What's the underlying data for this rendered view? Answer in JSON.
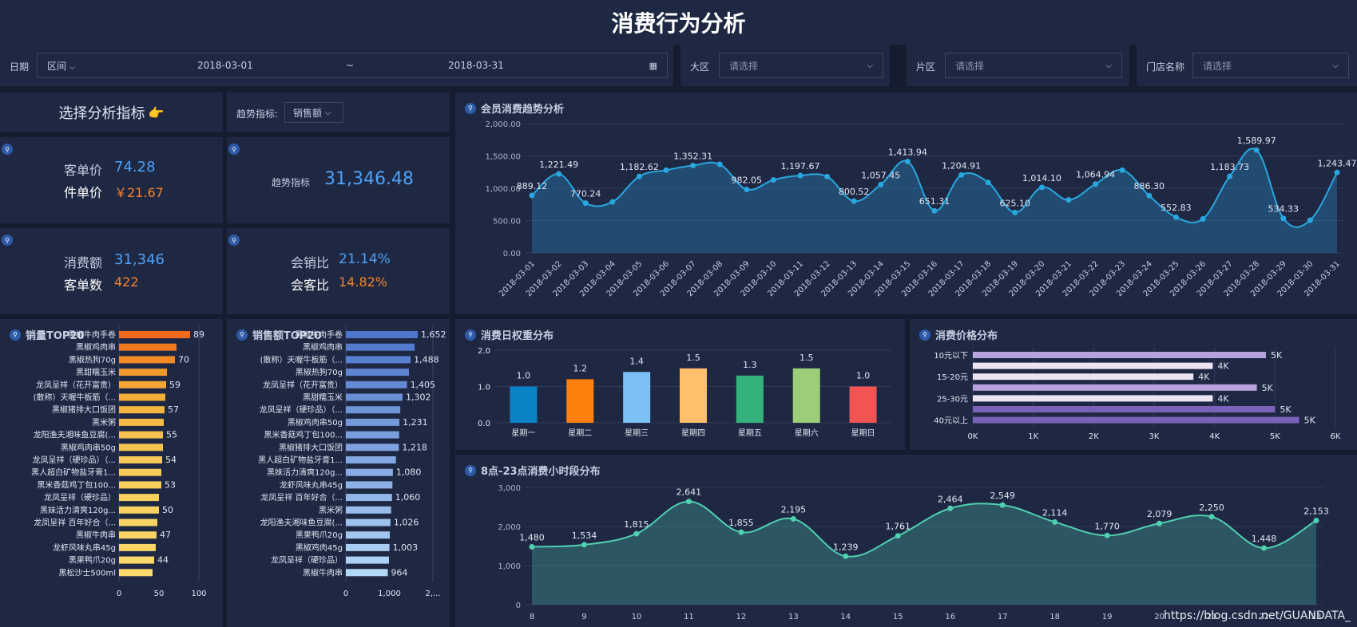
{
  "page_title": "消费行为分析",
  "filters": {
    "date_label": "日期",
    "range_mode": "区间",
    "date_from": "2018-03-01",
    "range_sep": "~",
    "date_to": "2018-03-31",
    "region_label": "大区",
    "region_placeholder": "请选择",
    "area_label": "片区",
    "area_placeholder": "请选择",
    "store_label": "门店名称",
    "store_placeholder": "请选择"
  },
  "selector": {
    "title": "选择分析指标",
    "pointer": "👉",
    "trend_label": "趋势指标:",
    "trend_value": "销售额"
  },
  "kpis": {
    "avg_price_label": "客单价",
    "avg_price": "74.28",
    "unit_price_label": "件单价",
    "unit_price": "￥21.67",
    "trend_label": "趋势指标",
    "trend_value": "31,346.48",
    "spend_label": "消费额",
    "spend": "31,346",
    "orders_label": "客单数",
    "orders": "422",
    "member_sales_label": "会销比",
    "member_sales": "21.14%",
    "member_customers_label": "会客比",
    "member_customers": "14.82%"
  },
  "colors": {
    "accent": "#4ea0f5",
    "orange": "#f5832b",
    "line_trend": "#29a8e0",
    "line_hour": "#4fd1b0"
  },
  "chart_data": [
    {
      "id": "trend",
      "type": "area",
      "title": "会员消费趋势分析",
      "x": [
        "2018-03-01",
        "2018-03-02",
        "2018-03-03",
        "2018-03-04",
        "2018-03-05",
        "2018-03-06",
        "2018-03-07",
        "2018-03-08",
        "2018-03-09",
        "2018-03-10",
        "2018-03-11",
        "2018-03-12",
        "2018-03-13",
        "2018-03-14",
        "2018-03-15",
        "2018-03-16",
        "2018-03-17",
        "2018-03-18",
        "2018-03-19",
        "2018-03-20",
        "2018-03-21",
        "2018-03-22",
        "2018-03-23",
        "2018-03-24",
        "2018-03-25",
        "2018-03-26",
        "2018-03-27",
        "2018-03-28",
        "2018-03-29",
        "2018-03-30",
        "2018-03-31"
      ],
      "values": [
        889.12,
        1221.49,
        770.24,
        790,
        1182.62,
        1280,
        1352.31,
        1370,
        982.05,
        1130,
        1197.67,
        1180,
        800.52,
        1057.45,
        1413.94,
        651.31,
        1204.91,
        1090,
        625.1,
        1014.1,
        820,
        1064.94,
        1280,
        886.3,
        552.83,
        525,
        1183.73,
        1589.97,
        534.33,
        505,
        1243.47
      ],
      "labels": [
        "889.12",
        "1,221.49",
        "770.24",
        "",
        "1,182.62",
        "",
        "1,352.31",
        "",
        "982.05",
        "",
        "1,197.67",
        "",
        "800.52",
        "1,057.45",
        "1,413.94",
        "651.31",
        "1,204.91",
        "",
        "625.10",
        "1,014.10",
        "",
        "1,064.94",
        "",
        "886.30",
        "552.83",
        "",
        "1,183.73",
        "1,589.97",
        "534.33",
        "",
        "1,243.47"
      ],
      "yticks": [
        "0.00",
        "500.00",
        "1,000.00",
        "1,500.00",
        "2,000.00"
      ],
      "ylim": [
        0,
        2000
      ]
    },
    {
      "id": "qty_top20",
      "type": "bar",
      "title": "销量TOP20",
      "categories": [
        "黑椒牛肉手卷",
        "黑椒鸡肉串",
        "黑椒热狗70g",
        "黑甜糯玉米",
        "龙凤呈祥（花开富贵）",
        "(散称）天喔牛板筋（...",
        "黑椒猪排大口饭团",
        "黑米粥",
        "龙阳渔夫湘味鱼豆腐(...",
        "黑椒鸡肉串50g",
        "龙凤呈祥（硬珍品）（...",
        "黑人超白矿物盐牙膏1...",
        "黑米香菇鸡丁包100...",
        "龙凤呈祥（硬珍品）",
        "黑妹活力清爽120g...",
        "龙凤呈祥 百年好合（...",
        "黑椒牛肉串",
        "龙虾风味丸串45g",
        "黑果鸭爪20g",
        "黑松沙士500ml"
      ],
      "values": [
        89,
        72,
        70,
        60,
        59,
        58,
        57,
        56,
        55,
        55,
        54,
        53,
        53,
        50,
        50,
        48,
        47,
        46,
        44,
        42
      ],
      "labels": [
        "89",
        "",
        "70",
        "",
        "59",
        "",
        "57",
        "",
        "55",
        "",
        "54",
        "",
        "53",
        "",
        "50",
        "",
        "47",
        "",
        "44",
        ""
      ],
      "xticks": [
        "0",
        "50",
        "100"
      ],
      "xlim": [
        0,
        100
      ]
    },
    {
      "id": "amt_top20",
      "type": "bar",
      "title": "销售额TOP20",
      "categories": [
        "黑椒牛肉手卷",
        "黑椒鸡肉串",
        "(散称）天喔牛板筋（...",
        "黑椒热狗70g",
        "龙凤呈祥（花开富贵）",
        "黑甜糯玉米",
        "龙凤呈祥（硬珍品）（...",
        "黑椒鸡肉串50g",
        "黑米香菇鸡丁包100...",
        "黑椒猪排大口饭团",
        "黑人超白矿物盐牙膏1...",
        "黑妹活力清爽120g...",
        "龙虾风味丸串45g",
        "龙凤呈祥 百年好合（...",
        "黑米粥",
        "龙阳渔夫湘味鱼豆腐(...",
        "黑果鸭爪20g",
        "黑椒鸡肉45g",
        "龙凤呈祥（硬珍品）",
        "黑椒牛肉串"
      ],
      "values": [
        1652,
        1580,
        1488,
        1450,
        1405,
        1302,
        1250,
        1231,
        1225,
        1218,
        1150,
        1080,
        1070,
        1060,
        1040,
        1026,
        1010,
        1003,
        990,
        964
      ],
      "labels": [
        "1,652",
        "",
        "1,488",
        "",
        "1,405",
        "1,302",
        "",
        "1,231",
        "",
        "1,218",
        "",
        "1,080",
        "",
        "1,060",
        "",
        "1,026",
        "",
        "1,003",
        "",
        "964"
      ],
      "xticks": [
        "0",
        "1,000",
        "2,..."
      ],
      "xlim": [
        0,
        2000
      ]
    },
    {
      "id": "weekday",
      "type": "bar",
      "title": "消费日权重分布",
      "categories": [
        "星期一",
        "星期二",
        "星期三",
        "星期四",
        "星期五",
        "星期六",
        "星期日"
      ],
      "values": [
        1.0,
        1.2,
        1.4,
        1.5,
        1.3,
        1.5,
        1.0
      ],
      "labels": [
        "1.0",
        "1.2",
        "1.4",
        "1.5",
        "1.3",
        "1.5",
        "1.0"
      ],
      "bar_colors": [
        "#0a83c6",
        "#ff7f0e",
        "#7cc0f5",
        "#ffbf6b",
        "#34b27b",
        "#9ccd78",
        "#f25454"
      ],
      "yticks": [
        "0.0",
        "1.0",
        "2.0"
      ],
      "ylim": [
        0,
        2
      ]
    },
    {
      "id": "price",
      "type": "bar",
      "title": "消费价格分布",
      "categories": [
        "10元以下",
        "",
        "15-20元",
        "",
        "25-30元",
        "",
        "40元以上"
      ],
      "values": [
        4850,
        3970,
        3650,
        4700,
        3970,
        5000,
        5400
      ],
      "labels": [
        "5K",
        "4K",
        "4K",
        "5K",
        "4K",
        "5K",
        "5K"
      ],
      "bar_colors": [
        "#b7a2dc",
        "#ece3f3",
        "#ece3f3",
        "#b7a2dc",
        "#ece3f3",
        "#7a62b8",
        "#7a62b8"
      ],
      "xticks": [
        "0K",
        "1K",
        "2K",
        "3K",
        "4K",
        "5K",
        "6K"
      ],
      "xlim": [
        0,
        6000
      ]
    },
    {
      "id": "hourly",
      "type": "area",
      "title": "8点-23点消费小时段分布",
      "x": [
        "8",
        "9",
        "10",
        "11",
        "12",
        "13",
        "14",
        "15",
        "16",
        "17",
        "18",
        "19",
        "20",
        "21",
        "22",
        "23"
      ],
      "values": [
        1480,
        1534,
        1815,
        2641,
        1855,
        2195,
        1239,
        1761,
        2464,
        2549,
        2114,
        1770,
        2079,
        2250,
        1448,
        2153
      ],
      "labels": [
        "1,480",
        "1,534",
        "1,815",
        "2,641",
        "1,855",
        "2,195",
        "1,239",
        "1,761",
        "2,464",
        "2,549",
        "2,114",
        "1,770",
        "2,079",
        "2,250",
        "1,448",
        "2,153"
      ],
      "yticks": [
        "0",
        "1,000",
        "2,000",
        "3,000"
      ],
      "ylim": [
        0,
        3000
      ]
    }
  ],
  "watermark": "https://blog.csdn.net/GUANDATA_"
}
